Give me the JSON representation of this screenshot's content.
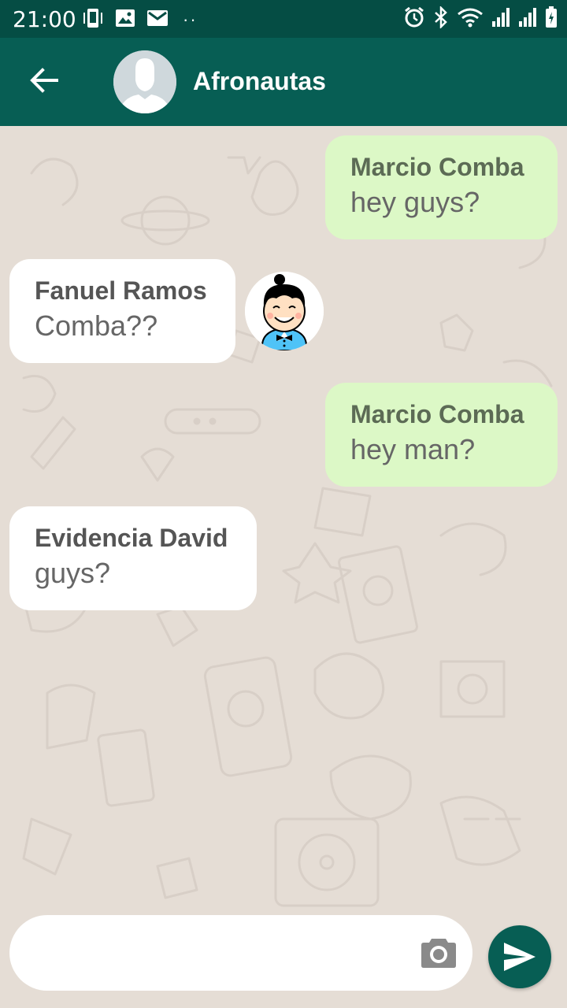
{
  "status_bar": {
    "time": "21:00",
    "left_icons": [
      "phone-vibrate-icon",
      "image-icon",
      "mail-icon"
    ],
    "more": "··",
    "right_icons": [
      "alarm-icon",
      "bluetooth-icon",
      "wifi-icon",
      "signal-icon",
      "signal-icon",
      "battery-charging-icon"
    ]
  },
  "header": {
    "back_icon": "arrow-back-icon",
    "avatar": "default-group-avatar",
    "title": "Afronautas",
    "color": "#075e54"
  },
  "messages": [
    {
      "direction": "outgoing",
      "sender": "Marcio Comba",
      "text": "hey guys?"
    },
    {
      "direction": "incoming",
      "sender": "Fanuel Ramos",
      "text": "Comba??",
      "avatar": "cartoon-boy-avatar"
    },
    {
      "direction": "outgoing",
      "sender": "Marcio Comba",
      "text": "hey man?"
    },
    {
      "direction": "incoming",
      "sender": "Evidencia David",
      "text": "guys?"
    }
  ],
  "composer": {
    "placeholder": "",
    "value": "",
    "camera_icon": "camera-icon",
    "send_icon": "send-icon"
  },
  "colors": {
    "primary_dark": "#054d44",
    "primary": "#075e54",
    "outgoing_bubble": "#dcf8c6",
    "incoming_bubble": "#ffffff",
    "wallpaper": "#e5ddd5"
  }
}
